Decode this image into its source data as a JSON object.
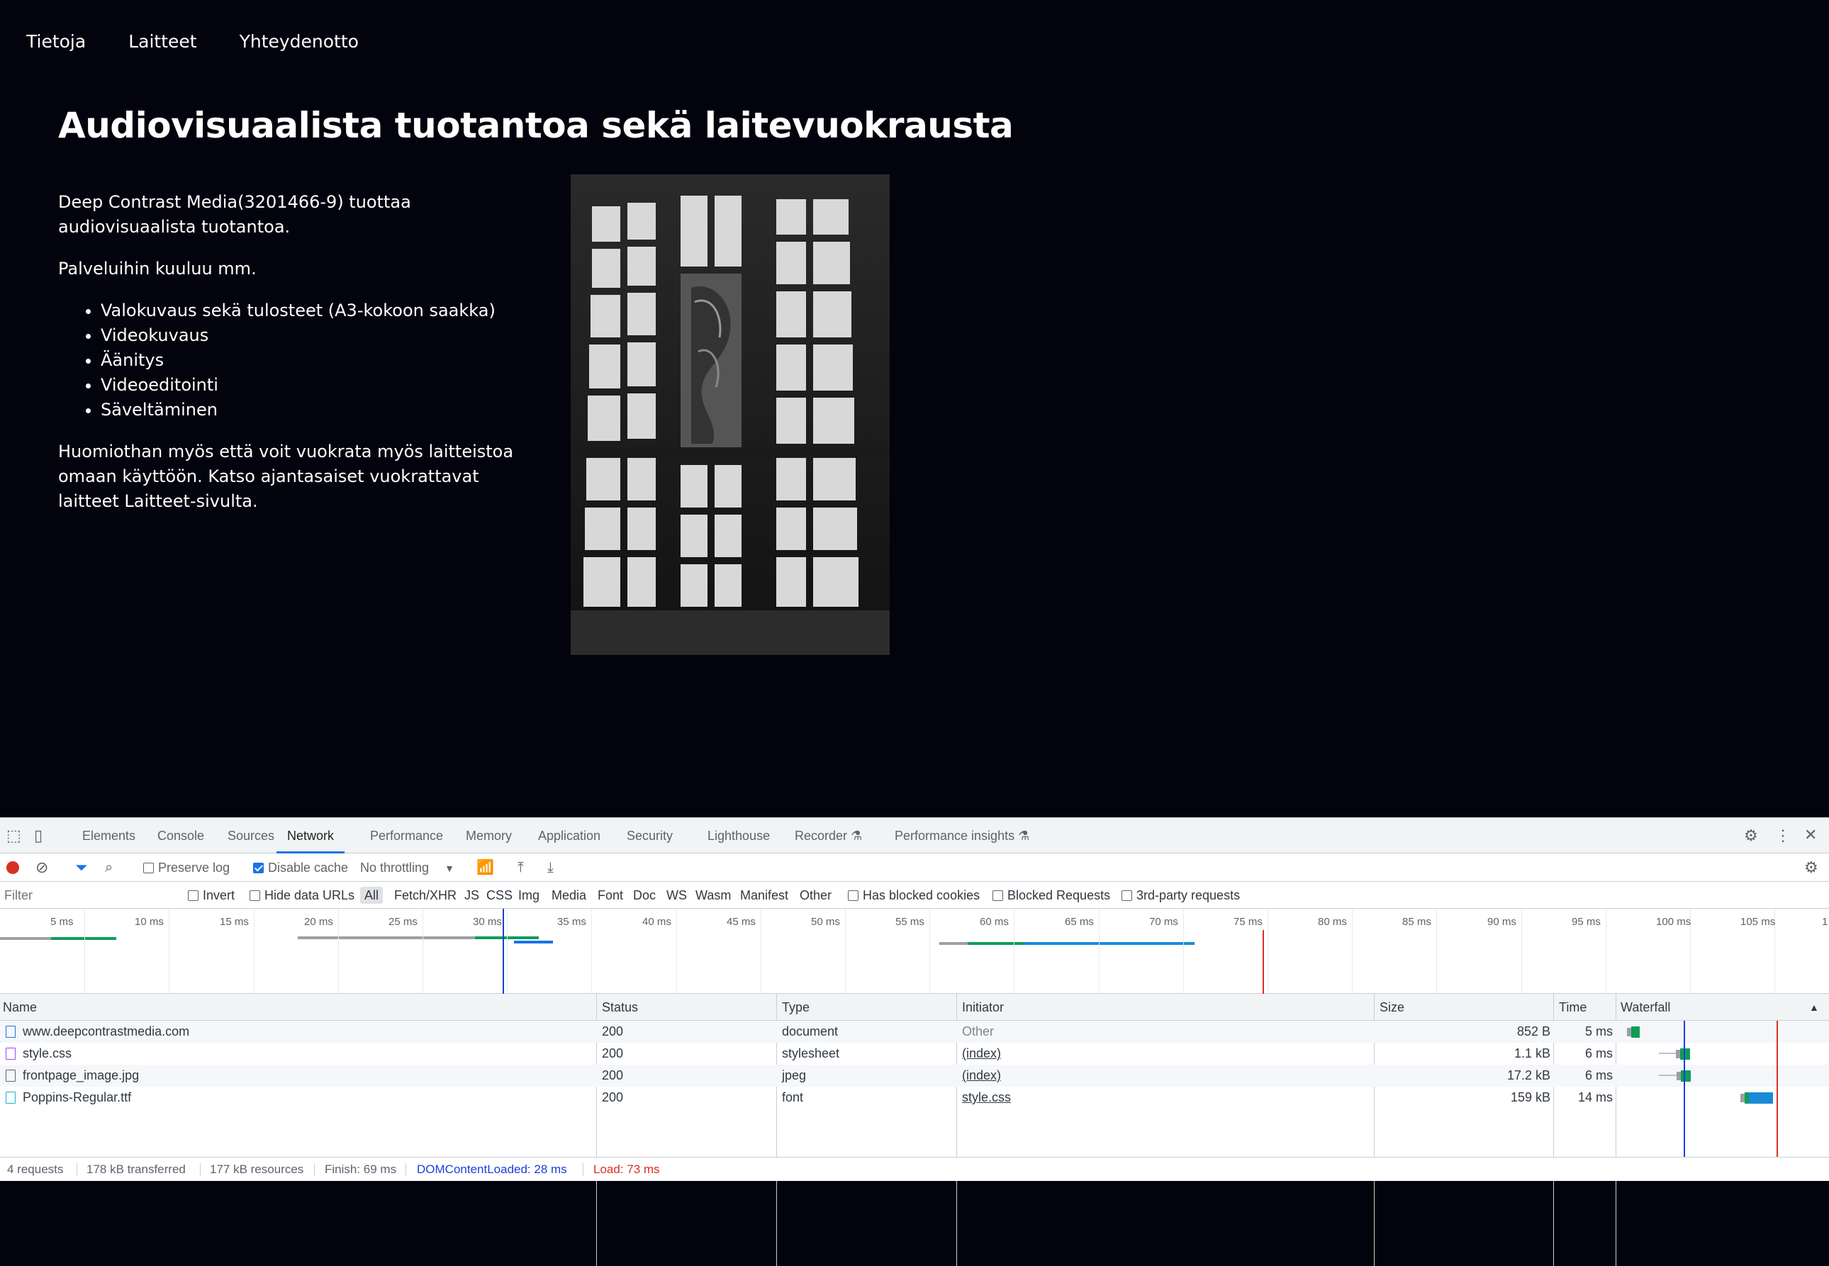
{
  "site": {
    "nav": [
      "Tietoja",
      "Laitteet",
      "Yhteydenotto"
    ],
    "title": "Audiovisuaalista tuotantoa sekä laitevuokrausta",
    "intro": "Deep Contrast Media(3201466-9) tuottaa audiovisuaalista tuotantoa.",
    "services_heading": "Palveluihin kuuluu mm.",
    "services": [
      "Valokuvaus sekä tulosteet (A3-kokoon saakka)",
      "Videokuvaus",
      "Äänitys",
      "Videoeditointi",
      "Säveltäminen"
    ],
    "rental_note": "Huomiothan myös että voit vuokrata myös laitteistoa omaan käyttöön. Katso ajantasaiset vuokrattavat laitteet Laitteet-sivulta."
  },
  "devtools": {
    "tabs": [
      "Elements",
      "Console",
      "Sources",
      "Network",
      "Performance",
      "Memory",
      "Application",
      "Security",
      "Lighthouse",
      "Recorder",
      "Performance insights"
    ],
    "active_tab": "Network",
    "toolbar": {
      "preserve_log": "Preserve log",
      "disable_cache": "Disable cache",
      "throttling": "No throttling"
    },
    "filter": {
      "placeholder": "Filter",
      "invert": "Invert",
      "hide_data_urls": "Hide data URLs",
      "types": [
        "All",
        "Fetch/XHR",
        "JS",
        "CSS",
        "Img",
        "Media",
        "Font",
        "Doc",
        "WS",
        "Wasm",
        "Manifest",
        "Other"
      ],
      "has_blocked_cookies": "Has blocked cookies",
      "blocked_requests": "Blocked Requests",
      "third_party": "3rd-party requests"
    },
    "overview_ticks": [
      "5 ms",
      "10 ms",
      "15 ms",
      "20 ms",
      "25 ms",
      "30 ms",
      "35 ms",
      "40 ms",
      "45 ms",
      "50 ms",
      "55 ms",
      "60 ms",
      "65 ms",
      "70 ms",
      "75 ms",
      "80 ms",
      "85 ms",
      "90 ms",
      "95 ms",
      "100 ms",
      "105 ms",
      "1"
    ],
    "columns": [
      "Name",
      "Status",
      "Type",
      "Initiator",
      "Size",
      "Time",
      "Waterfall"
    ],
    "rows": [
      {
        "name": "www.deepcontrastmedia.com",
        "status": "200",
        "type": "document",
        "initiator": "Other",
        "size": "852 B",
        "time": "5 ms",
        "icon": "document-icon",
        "color": "#1a73e8"
      },
      {
        "name": "style.css",
        "status": "200",
        "type": "stylesheet",
        "initiator": "(index)",
        "size": "1.1 kB",
        "time": "6 ms",
        "icon": "stylesheet-icon",
        "color": "#a142f4"
      },
      {
        "name": "frontpage_image.jpg",
        "status": "200",
        "type": "jpeg",
        "initiator": "(index)",
        "size": "17.2 kB",
        "time": "6 ms",
        "icon": "image-icon",
        "color": "#5f6368"
      },
      {
        "name": "Poppins-Regular.ttf",
        "status": "200",
        "type": "font",
        "initiator": "style.css",
        "size": "159 kB",
        "time": "14 ms",
        "icon": "font-icon",
        "color": "#12b5cb"
      }
    ],
    "status": {
      "requests": "4 requests",
      "transferred": "178 kB transferred",
      "resources": "177 kB resources",
      "finish": "Finish: 69 ms",
      "dcl": "DOMContentLoaded: 28 ms",
      "load": "Load: 73 ms"
    }
  }
}
